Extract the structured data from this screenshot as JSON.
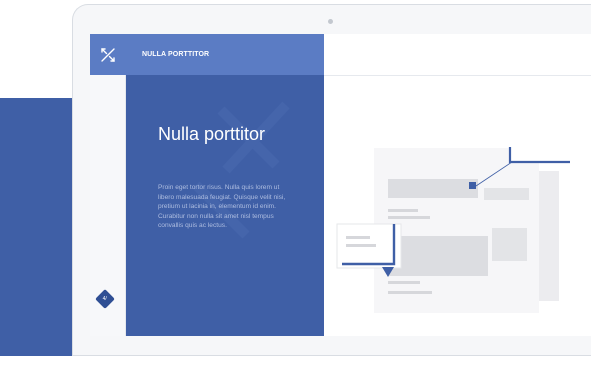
{
  "app": {
    "header_title": "NULLA PORTTITOR",
    "nav_badge_label": "4/"
  },
  "content": {
    "heading": "Nulla porttitor",
    "body": "Proin eget tortor risus. Nulla quis lorem ut libero malesuada feugiat. Quisque velit nisi, pretium ut lacinia in, elementum id enim. Curabitur non nulla sit amet nisl tempus convallis quis ac lectus."
  },
  "icons": {
    "logo": "x-arrows-logo-icon",
    "nav_badge": "diamond-badge-icon"
  },
  "colors": {
    "brand_blue": "#3f5fa6",
    "header_blue": "#5b7cc4",
    "accent_navy": "#2f4f94"
  }
}
